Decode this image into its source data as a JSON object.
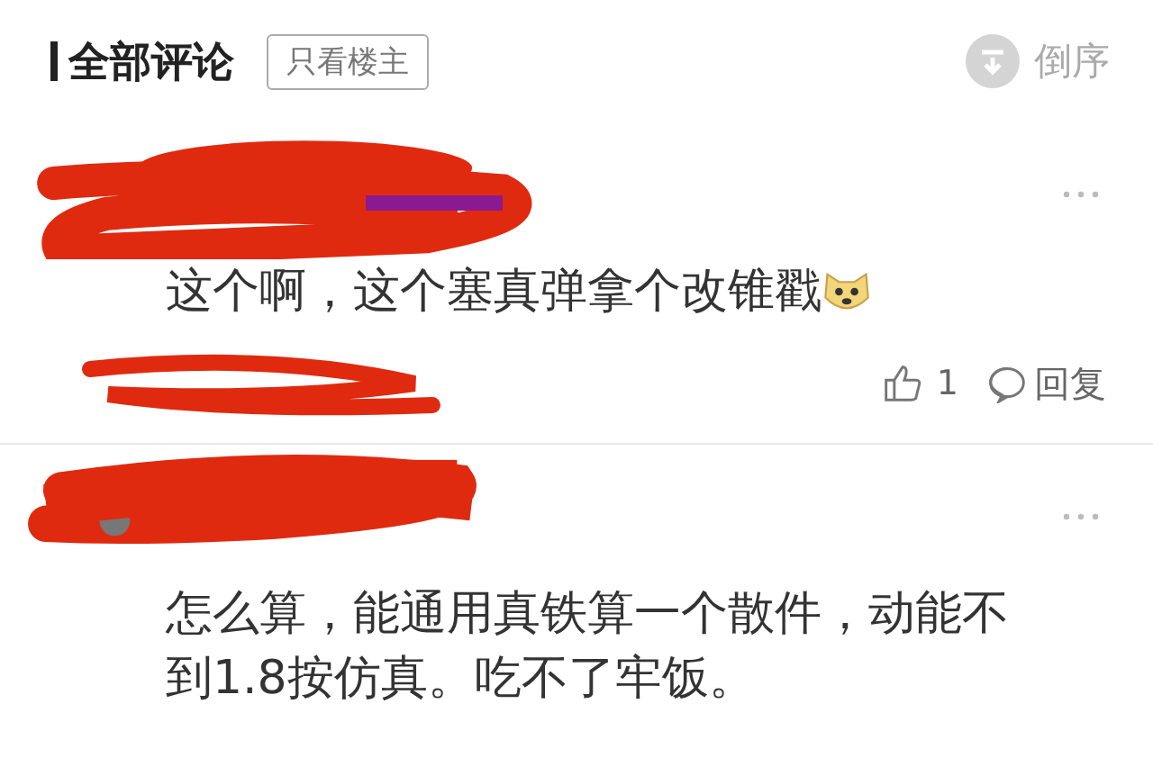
{
  "header": {
    "title": "全部评论",
    "filter_button": "只看楼主",
    "sort_label": "倒序"
  },
  "comments": [
    {
      "text": "这个啊，这个塞真弹拿个改锥戳",
      "emoji": true,
      "likes": "1",
      "reply_label": "回复"
    },
    {
      "text": "怎么算，能通用真铁算一个散件，动能不到1.8按仿真。吃不了牢饭。",
      "emoji": false
    }
  ]
}
